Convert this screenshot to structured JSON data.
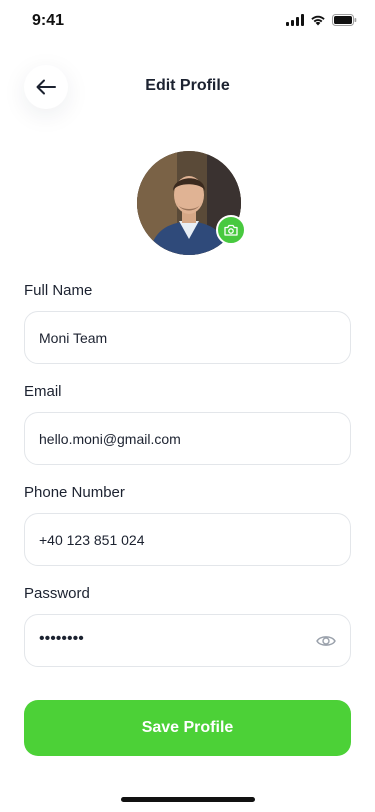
{
  "status_bar": {
    "time": "9:41"
  },
  "header": {
    "title": "Edit Profile"
  },
  "form": {
    "full_name": {
      "label": "Full Name",
      "value": "Moni Team"
    },
    "email": {
      "label": "Email",
      "value": "hello.moni@gmail.com"
    },
    "phone": {
      "label": "Phone Number",
      "value": "+40 123 851 024"
    },
    "password": {
      "label": "Password",
      "value": "••••••••"
    }
  },
  "save_button": {
    "label": "Save Profile"
  },
  "colors": {
    "accent": "#4cd137",
    "camera_badge": "#48c93f",
    "text": "#1c2230",
    "border": "#e3e6ea"
  },
  "icons": [
    "back-arrow-icon",
    "camera-icon",
    "eye-icon",
    "signal-icon",
    "wifi-icon",
    "battery-icon"
  ]
}
